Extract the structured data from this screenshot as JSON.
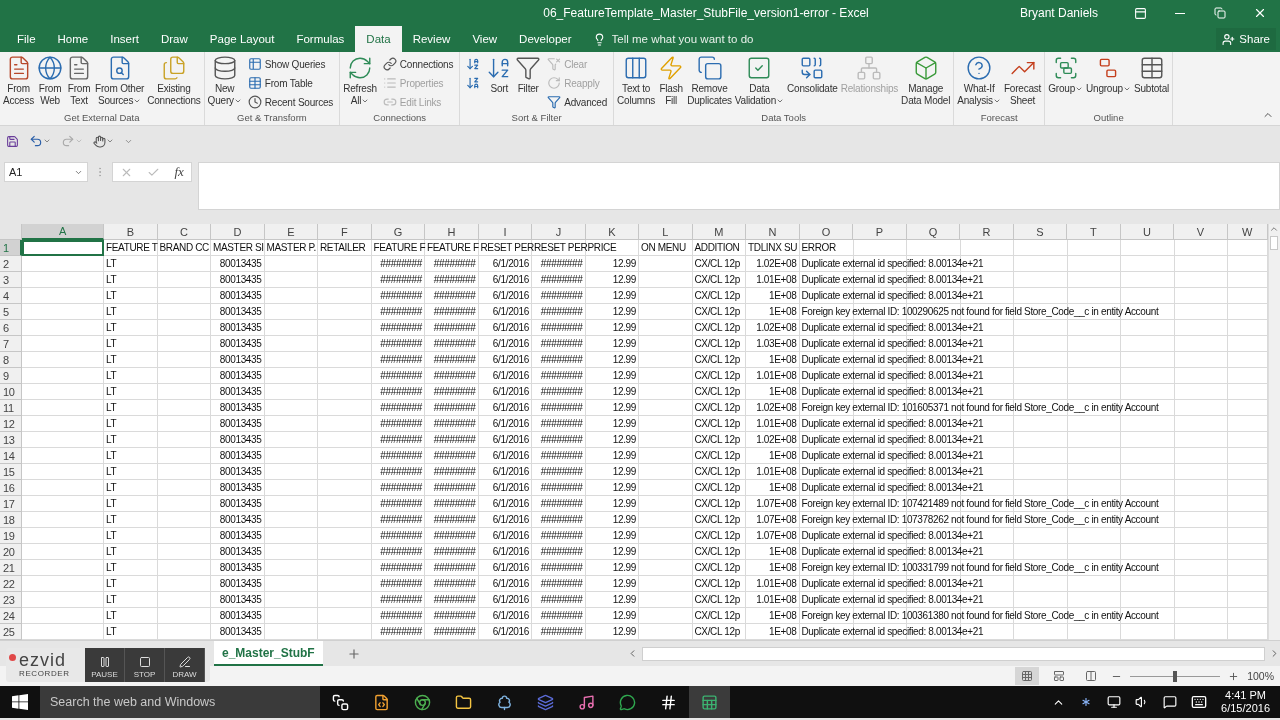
{
  "window": {
    "title": "06_FeatureTemplate_Master_StubFile_version1-error - Excel",
    "user": "Bryant Daniels"
  },
  "tabs": [
    {
      "label": "File",
      "selected": false
    },
    {
      "label": "Home",
      "selected": false
    },
    {
      "label": "Insert",
      "selected": false
    },
    {
      "label": "Draw",
      "selected": false
    },
    {
      "label": "Page Layout",
      "selected": false
    },
    {
      "label": "Formulas",
      "selected": false
    },
    {
      "label": "Data",
      "selected": true
    },
    {
      "label": "Review",
      "selected": false
    },
    {
      "label": "View",
      "selected": false
    },
    {
      "label": "Developer",
      "selected": false
    }
  ],
  "tell_me": {
    "placeholder": "Tell me what you want to do"
  },
  "share": "Share",
  "ribbon": [
    {
      "label": "Get External Data",
      "items": [
        {
          "kind": "large",
          "label": "From\nAccess",
          "disabled": false,
          "dropdown": false
        },
        {
          "kind": "large",
          "label": "From\nWeb",
          "disabled": false,
          "dropdown": false
        },
        {
          "kind": "large",
          "label": "From\nText",
          "disabled": false,
          "dropdown": false
        },
        {
          "kind": "large",
          "label": "From Other\nSources",
          "disabled": false,
          "dropdown": true
        },
        {
          "kind": "large",
          "label": "Existing\nConnections",
          "disabled": false,
          "dropdown": false
        }
      ]
    },
    {
      "label": "Get & Transform",
      "items": [
        {
          "kind": "large",
          "label": "New\nQuery",
          "disabled": false,
          "dropdown": true
        },
        {
          "kind": "small",
          "label": "Show Queries",
          "disabled": false,
          "dropdown": false
        },
        {
          "kind": "small",
          "label": "From Table",
          "disabled": false,
          "dropdown": false
        },
        {
          "kind": "small",
          "label": "Recent Sources",
          "disabled": false,
          "dropdown": false
        }
      ]
    },
    {
      "label": "Connections",
      "items": [
        {
          "kind": "large",
          "label": "Refresh\nAll",
          "disabled": false,
          "dropdown": true
        },
        {
          "kind": "small",
          "label": "Connections",
          "disabled": false,
          "dropdown": false
        },
        {
          "kind": "small",
          "label": "Properties",
          "disabled": true,
          "dropdown": false
        },
        {
          "kind": "small",
          "label": "Edit Links",
          "disabled": true,
          "dropdown": false
        }
      ]
    },
    {
      "label": "Sort & Filter",
      "items": [
        {
          "kind": "icon",
          "disabled": false,
          "dropdown": false
        },
        {
          "kind": "icon",
          "disabled": false,
          "dropdown": false
        },
        {
          "kind": "large",
          "label": "Sort",
          "disabled": false,
          "dropdown": false
        },
        {
          "kind": "large",
          "label": "Filter",
          "disabled": false,
          "dropdown": false
        },
        {
          "kind": "small",
          "label": "Clear",
          "disabled": true,
          "dropdown": false
        },
        {
          "kind": "small",
          "label": "Reapply",
          "disabled": true,
          "dropdown": false
        },
        {
          "kind": "small",
          "label": "Advanced",
          "disabled": false,
          "dropdown": false
        }
      ]
    },
    {
      "label": "Data Tools",
      "items": [
        {
          "kind": "large",
          "label": "Text to\nColumns",
          "disabled": false,
          "dropdown": false
        },
        {
          "kind": "large",
          "label": "Flash\nFill",
          "disabled": false,
          "dropdown": false
        },
        {
          "kind": "large",
          "label": "Remove\nDuplicates",
          "disabled": false,
          "dropdown": false
        },
        {
          "kind": "large",
          "label": "Data\nValidation",
          "disabled": false,
          "dropdown": true
        },
        {
          "kind": "large",
          "label": "Consolidate",
          "disabled": false,
          "dropdown": false
        },
        {
          "kind": "large",
          "label": "Relationships",
          "disabled": true,
          "dropdown": false
        },
        {
          "kind": "large",
          "label": "Manage\nData Model",
          "disabled": false,
          "dropdown": false
        }
      ]
    },
    {
      "label": "Forecast",
      "items": [
        {
          "kind": "large",
          "label": "What-If\nAnalysis",
          "disabled": false,
          "dropdown": true
        },
        {
          "kind": "large",
          "label": "Forecast\nSheet",
          "disabled": false,
          "dropdown": false
        }
      ]
    },
    {
      "label": "Outline",
      "items": [
        {
          "kind": "large",
          "label": "Group",
          "disabled": false,
          "dropdown": true
        },
        {
          "kind": "large",
          "label": "Ungroup",
          "disabled": false,
          "dropdown": true
        },
        {
          "kind": "large",
          "label": "Subtotal",
          "disabled": false,
          "dropdown": false
        }
      ]
    }
  ],
  "name_box": "A1",
  "function_label": "fx",
  "columns": [
    {
      "label": "A",
      "selected": true,
      "kind": "text"
    },
    {
      "label": "B",
      "selected": false,
      "kind": "text"
    },
    {
      "label": "C",
      "selected": false,
      "kind": "text"
    },
    {
      "label": "D",
      "selected": false,
      "kind": "number"
    },
    {
      "label": "E",
      "selected": false,
      "kind": "text"
    },
    {
      "label": "F",
      "selected": false,
      "kind": "text"
    },
    {
      "label": "G",
      "selected": false,
      "kind": "number"
    },
    {
      "label": "H",
      "selected": false,
      "kind": "number"
    },
    {
      "label": "I",
      "selected": false,
      "kind": "number"
    },
    {
      "label": "J",
      "selected": false,
      "kind": "number"
    },
    {
      "label": "K",
      "selected": false,
      "kind": "number"
    },
    {
      "label": "L",
      "selected": false,
      "kind": "text"
    },
    {
      "label": "M",
      "selected": false,
      "kind": "text"
    },
    {
      "label": "N",
      "selected": false,
      "kind": "number"
    },
    {
      "label": "O",
      "selected": false,
      "kind": "text"
    },
    {
      "label": "P",
      "selected": false
    },
    {
      "label": "Q",
      "selected": false
    },
    {
      "label": "R",
      "selected": false
    },
    {
      "label": "S",
      "selected": false
    },
    {
      "label": "T",
      "selected": false
    },
    {
      "label": "U",
      "selected": false
    },
    {
      "label": "V",
      "selected": false
    },
    {
      "label": "W",
      "selected": false
    }
  ],
  "rows": [
    {
      "label": "1",
      "selected": true,
      "kind": "text",
      "cells": [
        "",
        "FEATURE T",
        "BRAND CC",
        "MASTER SI",
        "MASTER P.",
        "RETAILER",
        "FEATURE F",
        "FEATURE F",
        "RESET PER",
        "RESET PER",
        "PRICE",
        "ON MENU",
        "ADDITION",
        "TDLINX SU",
        "ERROR"
      ]
    },
    {
      "label": "2",
      "selected": false,
      "kind": "data",
      "cells": [
        "",
        "LT",
        "",
        "80013435",
        "",
        "",
        "########",
        "########",
        "6/1/2016",
        "########",
        "12.99",
        "",
        "CX/CL 12p",
        "1.02E+08",
        "Duplicate external id specified: 8.00134e+21"
      ]
    },
    {
      "label": "3",
      "selected": false,
      "kind": "data",
      "cells": [
        "",
        "LT",
        "",
        "80013435",
        "",
        "",
        "########",
        "########",
        "6/1/2016",
        "########",
        "12.99",
        "",
        "CX/CL 12p",
        "1.01E+08",
        "Duplicate external id specified: 8.00134e+21"
      ]
    },
    {
      "label": "4",
      "selected": false,
      "kind": "data",
      "cells": [
        "",
        "LT",
        "",
        "80013435",
        "",
        "",
        "########",
        "########",
        "6/1/2016",
        "########",
        "12.99",
        "",
        "CX/CL 12p",
        "1E+08",
        "Duplicate external id specified: 8.00134e+21"
      ]
    },
    {
      "label": "5",
      "selected": false,
      "kind": "data",
      "cells": [
        "",
        "LT",
        "",
        "80013435",
        "",
        "",
        "########",
        "########",
        "6/1/2016",
        "########",
        "12.99",
        "",
        "CX/CL 12p",
        "1E+08",
        "Foreign key external ID: 100290625 not found for field Store_Code__c in entity Account"
      ]
    },
    {
      "label": "6",
      "selected": false,
      "kind": "data",
      "cells": [
        "",
        "LT",
        "",
        "80013435",
        "",
        "",
        "########",
        "########",
        "6/1/2016",
        "########",
        "12.99",
        "",
        "CX/CL 12p",
        "1.02E+08",
        "Duplicate external id specified: 8.00134e+21"
      ]
    },
    {
      "label": "7",
      "selected": false,
      "kind": "data",
      "cells": [
        "",
        "LT",
        "",
        "80013435",
        "",
        "",
        "########",
        "########",
        "6/1/2016",
        "########",
        "12.99",
        "",
        "CX/CL 12p",
        "1.03E+08",
        "Duplicate external id specified: 8.00134e+21"
      ]
    },
    {
      "label": "8",
      "selected": false,
      "kind": "data",
      "cells": [
        "",
        "LT",
        "",
        "80013435",
        "",
        "",
        "########",
        "########",
        "6/1/2016",
        "########",
        "12.99",
        "",
        "CX/CL 12p",
        "1E+08",
        "Duplicate external id specified: 8.00134e+21"
      ]
    },
    {
      "label": "9",
      "selected": false,
      "kind": "data",
      "cells": [
        "",
        "LT",
        "",
        "80013435",
        "",
        "",
        "########",
        "########",
        "6/1/2016",
        "########",
        "12.99",
        "",
        "CX/CL 12p",
        "1.01E+08",
        "Duplicate external id specified: 8.00134e+21"
      ]
    },
    {
      "label": "10",
      "selected": false,
      "kind": "data",
      "cells": [
        "",
        "LT",
        "",
        "80013435",
        "",
        "",
        "########",
        "########",
        "6/1/2016",
        "########",
        "12.99",
        "",
        "CX/CL 12p",
        "1E+08",
        "Duplicate external id specified: 8.00134e+21"
      ]
    },
    {
      "label": "11",
      "selected": false,
      "kind": "data",
      "cells": [
        "",
        "LT",
        "",
        "80013435",
        "",
        "",
        "########",
        "########",
        "6/1/2016",
        "########",
        "12.99",
        "",
        "CX/CL 12p",
        "1.02E+08",
        "Foreign key external ID: 101605371 not found for field Store_Code__c in entity Account"
      ]
    },
    {
      "label": "12",
      "selected": false,
      "kind": "data",
      "cells": [
        "",
        "LT",
        "",
        "80013435",
        "",
        "",
        "########",
        "########",
        "6/1/2016",
        "########",
        "12.99",
        "",
        "CX/CL 12p",
        "1.01E+08",
        "Duplicate external id specified: 8.00134e+21"
      ]
    },
    {
      "label": "13",
      "selected": false,
      "kind": "data",
      "cells": [
        "",
        "LT",
        "",
        "80013435",
        "",
        "",
        "########",
        "########",
        "6/1/2016",
        "########",
        "12.99",
        "",
        "CX/CL 12p",
        "1.02E+08",
        "Duplicate external id specified: 8.00134e+21"
      ]
    },
    {
      "label": "14",
      "selected": false,
      "kind": "data",
      "cells": [
        "",
        "LT",
        "",
        "80013435",
        "",
        "",
        "########",
        "########",
        "6/1/2016",
        "########",
        "12.99",
        "",
        "CX/CL 12p",
        "1E+08",
        "Duplicate external id specified: 8.00134e+21"
      ]
    },
    {
      "label": "15",
      "selected": false,
      "kind": "data",
      "cells": [
        "",
        "LT",
        "",
        "80013435",
        "",
        "",
        "########",
        "########",
        "6/1/2016",
        "########",
        "12.99",
        "",
        "CX/CL 12p",
        "1.01E+08",
        "Duplicate external id specified: 8.00134e+21"
      ]
    },
    {
      "label": "16",
      "selected": false,
      "kind": "data",
      "cells": [
        "",
        "LT",
        "",
        "80013435",
        "",
        "",
        "########",
        "########",
        "6/1/2016",
        "########",
        "12.99",
        "",
        "CX/CL 12p",
        "1E+08",
        "Duplicate external id specified: 8.00134e+21"
      ]
    },
    {
      "label": "17",
      "selected": false,
      "kind": "data",
      "cells": [
        "",
        "LT",
        "",
        "80013435",
        "",
        "",
        "########",
        "########",
        "6/1/2016",
        "########",
        "12.99",
        "",
        "CX/CL 12p",
        "1.07E+08",
        "Foreign key external ID: 107421489 not found for field Store_Code__c in entity Account"
      ]
    },
    {
      "label": "18",
      "selected": false,
      "kind": "data",
      "cells": [
        "",
        "LT",
        "",
        "80013435",
        "",
        "",
        "########",
        "########",
        "6/1/2016",
        "########",
        "12.99",
        "",
        "CX/CL 12p",
        "1.07E+08",
        "Foreign key external ID: 107378262 not found for field Store_Code__c in entity Account"
      ]
    },
    {
      "label": "19",
      "selected": false,
      "kind": "data",
      "cells": [
        "",
        "LT",
        "",
        "80013435",
        "",
        "",
        "########",
        "########",
        "6/1/2016",
        "########",
        "12.99",
        "",
        "CX/CL 12p",
        "1.07E+08",
        "Duplicate external id specified: 8.00134e+21"
      ]
    },
    {
      "label": "20",
      "selected": false,
      "kind": "data",
      "cells": [
        "",
        "LT",
        "",
        "80013435",
        "",
        "",
        "########",
        "########",
        "6/1/2016",
        "########",
        "12.99",
        "",
        "CX/CL 12p",
        "1E+08",
        "Duplicate external id specified: 8.00134e+21"
      ]
    },
    {
      "label": "21",
      "selected": false,
      "kind": "data",
      "cells": [
        "",
        "LT",
        "",
        "80013435",
        "",
        "",
        "########",
        "########",
        "6/1/2016",
        "########",
        "12.99",
        "",
        "CX/CL 12p",
        "1E+08",
        "Foreign key external ID: 100331799 not found for field Store_Code__c in entity Account"
      ]
    },
    {
      "label": "22",
      "selected": false,
      "kind": "data",
      "cells": [
        "",
        "LT",
        "",
        "80013435",
        "",
        "",
        "########",
        "########",
        "6/1/2016",
        "########",
        "12.99",
        "",
        "CX/CL 12p",
        "1.01E+08",
        "Duplicate external id specified: 8.00134e+21"
      ]
    },
    {
      "label": "23",
      "selected": false,
      "kind": "data",
      "cells": [
        "",
        "LT",
        "",
        "80013435",
        "",
        "",
        "########",
        "########",
        "6/1/2016",
        "########",
        "12.99",
        "",
        "CX/CL 12p",
        "1.01E+08",
        "Duplicate external id specified: 8.00134e+21"
      ]
    },
    {
      "label": "24",
      "selected": false,
      "kind": "data",
      "cells": [
        "",
        "LT",
        "",
        "80013435",
        "",
        "",
        "########",
        "########",
        "6/1/2016",
        "########",
        "12.99",
        "",
        "CX/CL 12p",
        "1E+08",
        "Foreign key external ID: 100361380 not found for field Store_Code__c in entity Account"
      ]
    },
    {
      "label": "25",
      "selected": false,
      "kind": "data",
      "cells": [
        "",
        "LT",
        "",
        "80013435",
        "",
        "",
        "########",
        "########",
        "6/1/2016",
        "########",
        "12.99",
        "",
        "CX/CL 12p",
        "1E+08",
        "Duplicate external id specified: 8.00134e+21"
      ]
    }
  ],
  "sheet_tabs": [
    {
      "label": "e_Master_StubF",
      "selected": true
    }
  ],
  "recorder": {
    "logo": "ezvid",
    "subtitle": "RECORDER",
    "buttons": [
      "PAUSE",
      "STOP",
      "DRAW"
    ]
  },
  "status_bar": {
    "views": [
      {
        "selected": true
      },
      {
        "selected": false
      },
      {
        "selected": false
      }
    ],
    "zoom": {
      "level": 0.5,
      "reading": "100%"
    }
  },
  "taskbar": {
    "search": {
      "placeholder": "Search the web and Windows"
    },
    "time": "4:41 PM",
    "date": "6/15/2016"
  }
}
